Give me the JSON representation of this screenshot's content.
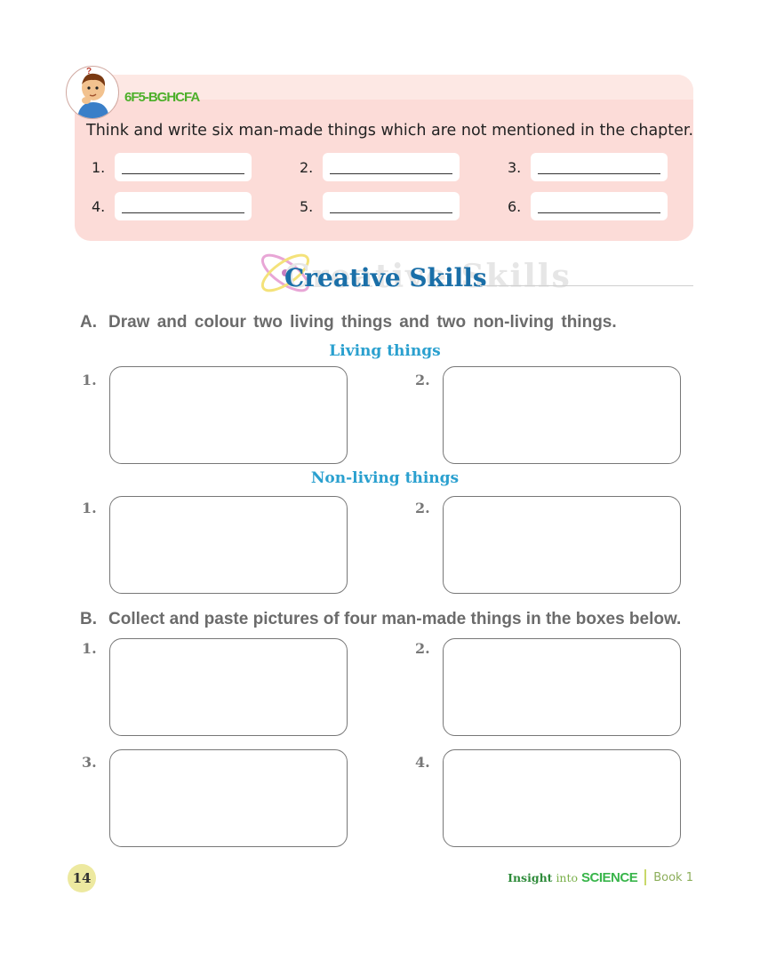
{
  "think_box": {
    "title": "6F5-BGHCFA",
    "question": "Think and write six man-made things which are not mentioned in the chapter.",
    "blanks": [
      "1.",
      "2.",
      "3.",
      "4.",
      "5.",
      "6."
    ]
  },
  "section_heading": "Creative Skills",
  "section_a": {
    "label": "A.",
    "text": "Draw and colour two living things and two non-living things.",
    "living_heading": "Living things",
    "non_living_heading": "Non-living things",
    "box_numbers": [
      "1.",
      "2.",
      "1.",
      "2."
    ]
  },
  "section_b": {
    "label": "B.",
    "text": "Collect and paste pictures of four man-made things in the boxes below.",
    "box_numbers": [
      "1.",
      "2.",
      "3.",
      "4."
    ]
  },
  "footer": {
    "page_number": "14",
    "insight": "Insight",
    "into": "into",
    "science": "SCIENCE",
    "book": "Book 1"
  },
  "colors": {
    "panel_pink": "#fcdcd8",
    "heading_blue": "#1a6fa8",
    "subheading_cyan": "#2aa0cf",
    "title_green": "#4caf2a"
  }
}
